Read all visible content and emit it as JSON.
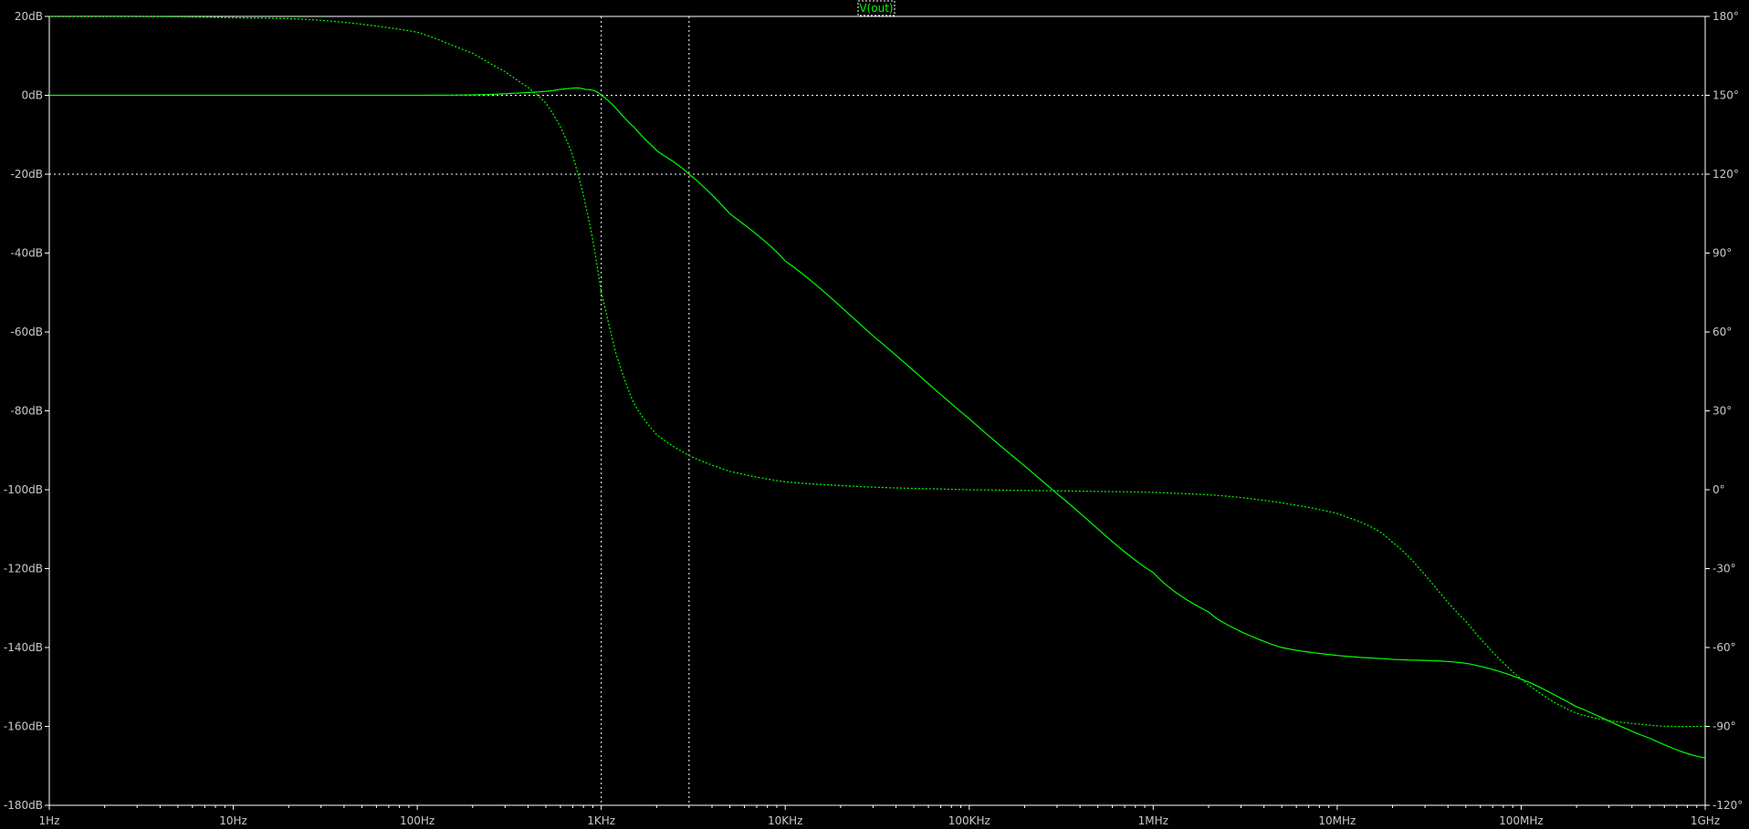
{
  "trace_label": "V(out)",
  "colors": {
    "background": "#000000",
    "frame": "#ffffff",
    "grid": "#ffffff",
    "trace": "#00ff00",
    "tick_text": "#c8c8c8"
  },
  "chart_data": {
    "type": "line",
    "title": "",
    "x_scale": "log",
    "xlim": [
      1,
      1000000000
    ],
    "x_ticks": [
      {
        "value": 1,
        "label": "1Hz"
      },
      {
        "value": 10,
        "label": "10Hz"
      },
      {
        "value": 100,
        "label": "100Hz"
      },
      {
        "value": 1000,
        "label": "1KHz"
      },
      {
        "value": 10000,
        "label": "10KHz"
      },
      {
        "value": 100000,
        "label": "100KHz"
      },
      {
        "value": 1000000,
        "label": "1MHz"
      },
      {
        "value": 10000000,
        "label": "10MHz"
      },
      {
        "value": 100000000,
        "label": "100MHz"
      },
      {
        "value": 1000000000,
        "label": "1GHz"
      }
    ],
    "y_left": {
      "range": [
        -180,
        20
      ],
      "ticks": [
        {
          "value": 20,
          "label": "20dB"
        },
        {
          "value": 0,
          "label": "0dB"
        },
        {
          "value": -20,
          "label": "-20dB"
        },
        {
          "value": -40,
          "label": "-40dB"
        },
        {
          "value": -60,
          "label": "-60dB"
        },
        {
          "value": -80,
          "label": "-80dB"
        },
        {
          "value": -100,
          "label": "-100dB"
        },
        {
          "value": -120,
          "label": "-120dB"
        },
        {
          "value": -140,
          "label": "-140dB"
        },
        {
          "value": -160,
          "label": "-160dB"
        },
        {
          "value": -180,
          "label": "-180dB"
        }
      ]
    },
    "y_right": {
      "range": [
        -120,
        180
      ],
      "ticks": [
        {
          "value": 180,
          "label": "180°"
        },
        {
          "value": 150,
          "label": "150°"
        },
        {
          "value": 120,
          "label": "120°"
        },
        {
          "value": 90,
          "label": "90°"
        },
        {
          "value": 60,
          "label": "60°"
        },
        {
          "value": 30,
          "label": "30°"
        },
        {
          "value": 0,
          "label": "0°"
        },
        {
          "value": -30,
          "label": "-30°"
        },
        {
          "value": -60,
          "label": "-60°"
        },
        {
          "value": -90,
          "label": "-90°"
        },
        {
          "value": -120,
          "label": "-120°"
        }
      ]
    },
    "grid": {
      "horizontal_left_values": [
        0,
        -20
      ],
      "vertical_x_values": [
        1000,
        3000
      ],
      "style": "dotted"
    },
    "series": [
      {
        "name": "V(out)",
        "quantity": "magnitude",
        "axis": "left",
        "line_style": "solid",
        "x": [
          1,
          10,
          100,
          200,
          300,
          500,
          700,
          800,
          1000,
          1500,
          2000,
          3000,
          5000,
          10000,
          30000,
          100000,
          300000,
          1000000,
          2000000,
          3000000,
          5000000,
          10000000,
          20000000,
          50000000,
          100000000,
          200000000,
          500000000,
          1000000000
        ],
        "y": [
          0,
          0,
          0,
          0.1,
          0.4,
          1,
          1.8,
          1.6,
          0,
          -8,
          -14,
          -20,
          -30,
          -42,
          -61,
          -82,
          -101,
          -121,
          -131,
          -136,
          -140,
          -142,
          -143,
          -144,
          -148,
          -155,
          -163,
          -168
        ]
      },
      {
        "name": "V(out)",
        "quantity": "phase",
        "axis": "right",
        "line_style": "dotted",
        "x": [
          1,
          3,
          10,
          30,
          100,
          200,
          300,
          400,
          500,
          600,
          700,
          800,
          900,
          1000,
          1200,
          1500,
          2000,
          3000,
          5000,
          10000,
          30000,
          100000,
          1000000,
          3000000,
          10000000,
          20000000,
          50000000,
          100000000,
          200000000,
          500000000,
          1000000000
        ],
        "y": [
          180,
          180,
          179.5,
          178.5,
          174,
          166,
          159,
          153,
          147,
          138,
          127,
          112,
          95,
          75,
          52,
          33,
          21,
          13,
          7,
          3,
          1,
          0,
          -1,
          -3,
          -9,
          -20,
          -50,
          -72,
          -85,
          -89.5,
          -90
        ]
      }
    ]
  }
}
